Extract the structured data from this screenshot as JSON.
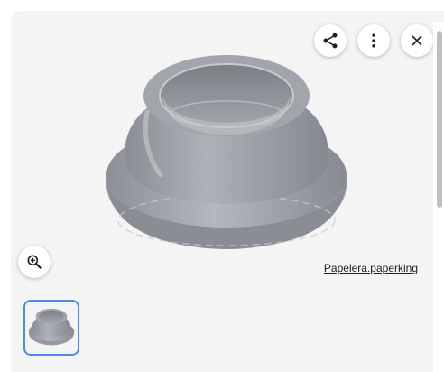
{
  "viewer": {
    "source_link": "Papelera.paperking",
    "image_alt": "Grey plastic dome lid with open centre"
  },
  "icons": {
    "share": "share-icon",
    "more": "more-vert-icon",
    "close": "close-icon",
    "zoom": "zoom-in-icon"
  },
  "colors": {
    "panel_bg": "#f4f4f4",
    "thumb_border": "#4a8af4",
    "lid_grey": "#9ea1a8"
  }
}
